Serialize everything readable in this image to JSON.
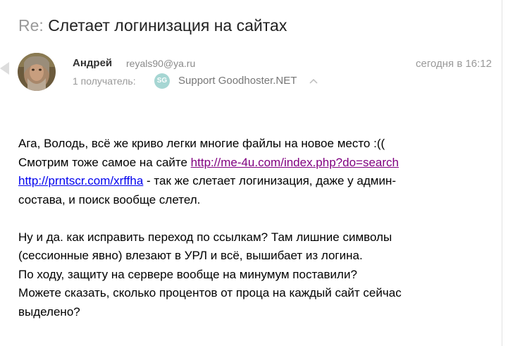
{
  "message": {
    "subject_prefix": "Re:",
    "subject_text": "Слетает логинизация на сайтах"
  },
  "sender": {
    "name": "Андрей",
    "email": "reyals90@ya.ru",
    "date": "сегодня в 16:12"
  },
  "recipients": {
    "label": "1 получатель:",
    "avatar_initials": "SG",
    "name": "Support Goodhoster.NET"
  },
  "body": {
    "line1": "Ага, Володь, всё же криво легки многие файлы на новое место :((",
    "line2_prefix": "Смотрим тоже самое на сайте ",
    "link1": "http://me-4u.com/index.php?do=search",
    "link2": "http://prntscr.com/xrffha",
    "line3_suffix": " - так же слетает логинизация, даже у админ-",
    "line4": "состава, и поиск вообще слетел.",
    "line5": "Ну и да. как исправить переход по ссылкам? Там лишние символы",
    "line6": "(сессионные явно) влезают в УРЛ и всё, вышибает из логина.",
    "line7": "По ходу, защиту на сервере вообще на минумум поставили?",
    "line8": "Можете сказать, сколько процентов от проца на каждый сайт сейчас",
    "line9": "выделено?"
  },
  "colors": {
    "link_visited": "#800080",
    "link": "#0000ee",
    "muted": "#999999",
    "recipient_avatar": "#a6d6d3"
  }
}
